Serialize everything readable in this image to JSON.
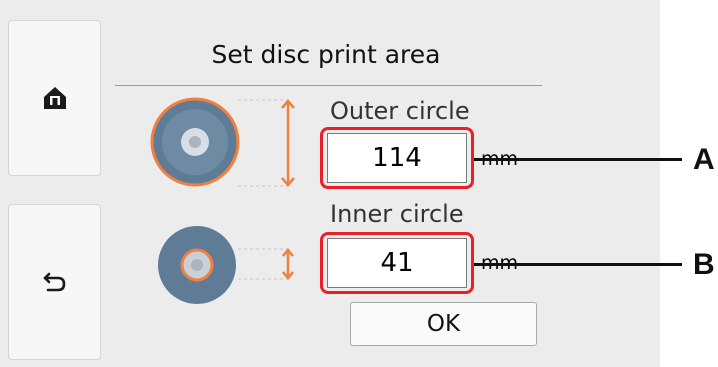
{
  "title": "Set disc print area",
  "outer": {
    "label": "Outer circle",
    "value": "114",
    "unit": "mm",
    "callout": "A"
  },
  "inner": {
    "label": "Inner circle",
    "value": "41",
    "unit": "mm",
    "callout": "B"
  },
  "ok_label": "OK",
  "icons": {
    "home": "home-icon",
    "back": "back-arrow-icon"
  },
  "colors": {
    "highlight": "#e8202a",
    "guide": "#f08040",
    "disc": "#5f7c96",
    "background": "#ececec"
  }
}
